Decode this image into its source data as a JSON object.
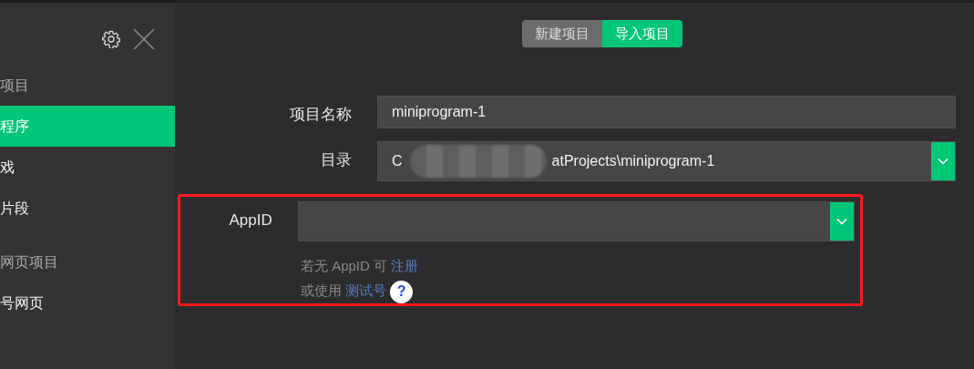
{
  "sidebar": {
    "items": [
      {
        "label": "项目",
        "kind": "heading",
        "selected": false
      },
      {
        "label": "程序",
        "kind": "item",
        "selected": true
      },
      {
        "label": "戏",
        "kind": "item",
        "selected": false
      },
      {
        "label": "片段",
        "kind": "item",
        "selected": false
      },
      {
        "label": "网页项目",
        "kind": "heading",
        "selected": false
      },
      {
        "label": "号网页",
        "kind": "item",
        "selected": false
      }
    ]
  },
  "mode_tabs": [
    {
      "label": "新建项目",
      "selected": false
    },
    {
      "label": "导入项目",
      "selected": true
    }
  ],
  "form": {
    "fields": [
      {
        "label": "项目名称",
        "kind": "text",
        "value_parts": [
          "miniprogram-1"
        ]
      },
      {
        "label": "目录",
        "kind": "select",
        "value_parts": [
          "C",
          "atProjects\\miniprogram-1"
        ],
        "redacted": true
      },
      {
        "label": "AppID",
        "kind": "select",
        "highlighted": true,
        "hints": [
          {
            "text": "若无 AppID 可",
            "link": "注册"
          },
          {
            "text": "或使用",
            "link": "测试号",
            "help": "?"
          }
        ]
      }
    ]
  }
}
